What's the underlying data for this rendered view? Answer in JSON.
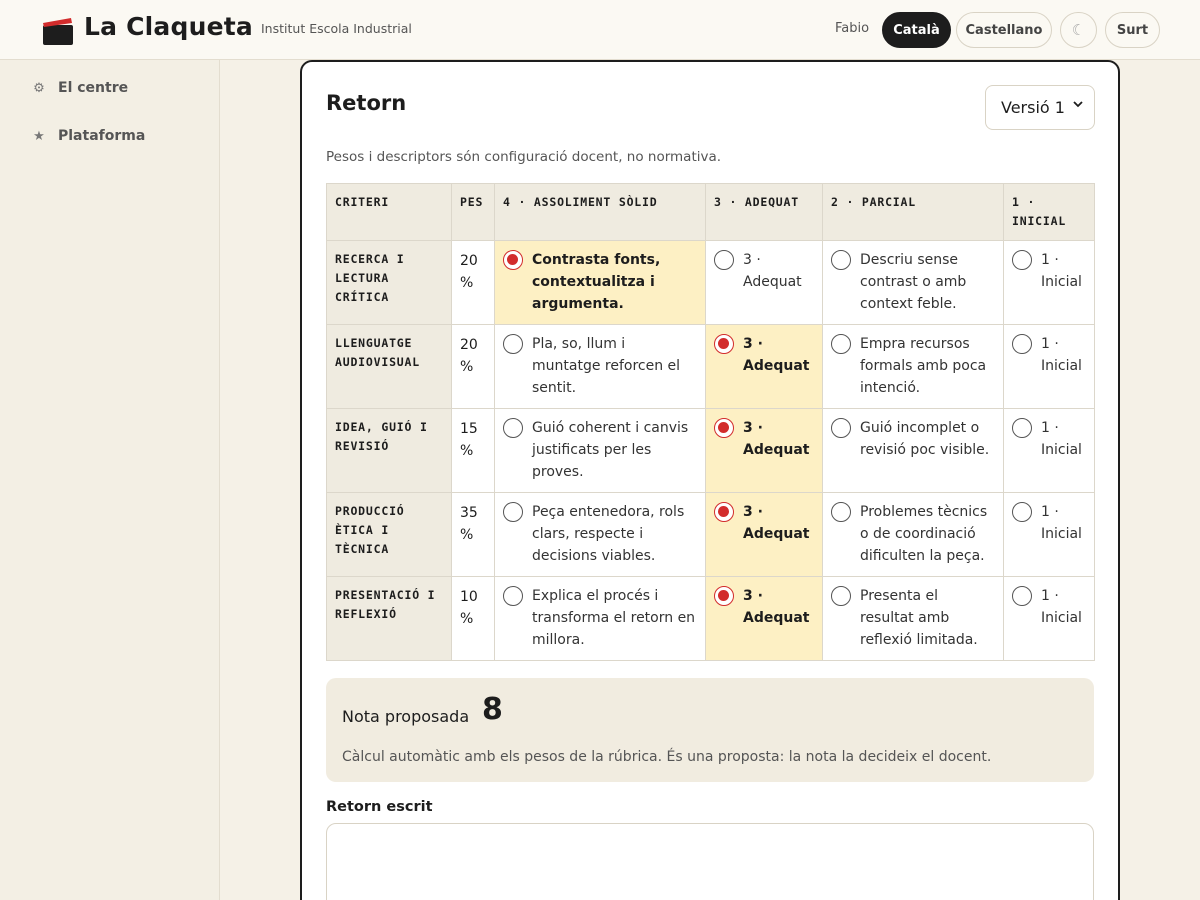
{
  "header": {
    "app_title": "La Claqueta",
    "school": "Institut Escola Industrial",
    "user": "Fabio",
    "lang_ca": "Català",
    "lang_es": "Castellano",
    "theme_icon": "☾",
    "logout": "Surt",
    "brand_color": "#d22c2c"
  },
  "sidebar": {
    "items": [
      {
        "label": "El centre",
        "icon": "gear-icon",
        "glyph": "⚙"
      },
      {
        "label": "Plataforma",
        "icon": "star-icon",
        "glyph": "★"
      }
    ]
  },
  "main": {
    "title": "Retorn",
    "version_selected": "Versió 1",
    "note": "Pesos i descriptors són configuració docent, no normativa.",
    "rubric": {
      "headers": [
        "CRITERI",
        "PES",
        "4 · ASSOLIMENT SÒLID",
        "3 · ADEQUAT",
        "2 · PARCIAL",
        "1 · INICIAL"
      ],
      "rows": [
        {
          "criterion": "RECERCA I LECTURA CRÍTICA",
          "weight": "20 %",
          "options": [
            "Contrasta fonts, contextualitza i argumenta.",
            "3 · Adequat",
            "Descriu sense contrast o amb context feble.",
            "1 · Inicial"
          ],
          "selected": 0
        },
        {
          "criterion": "LLENGUATGE AUDIOVISUAL",
          "weight": "20 %",
          "options": [
            "Pla, so, llum i muntatge reforcen el sentit.",
            "3 · Adequat",
            "Empra recursos formals amb poca intenció.",
            "1 · Inicial"
          ],
          "selected": 1
        },
        {
          "criterion": "IDEA, GUIÓ I REVISIÓ",
          "weight": "15 %",
          "options": [
            "Guió coherent i canvis justificats per les proves.",
            "3 · Adequat",
            "Guió incomplet o revisió poc visible.",
            "1 · Inicial"
          ],
          "selected": 1
        },
        {
          "criterion": "PRODUCCIÓ ÈTICA I TÈCNICA",
          "weight": "35 %",
          "options": [
            "Peça entenedora, rols clars, respecte i decisions viables.",
            "3 · Adequat",
            "Problemes tècnics o de coordinació dificulten la peça.",
            "1 · Inicial"
          ],
          "selected": 1
        },
        {
          "criterion": "PRESENTACIÓ I REFLEXIÓ",
          "weight": "10 %",
          "options": [
            "Explica el procés i transforma el retorn en millora.",
            "3 · Adequat",
            "Presenta el resultat amb reflexió limitada.",
            "1 · Inicial"
          ],
          "selected": 1
        }
      ]
    },
    "grade": {
      "label": "Nota proposada",
      "value": "8",
      "help": "Càlcul automàtic amb els pesos de la rúbrica. És una proposta: la nota la decideix el docent."
    },
    "feedback": {
      "label": "Retorn escrit",
      "value": ""
    }
  }
}
